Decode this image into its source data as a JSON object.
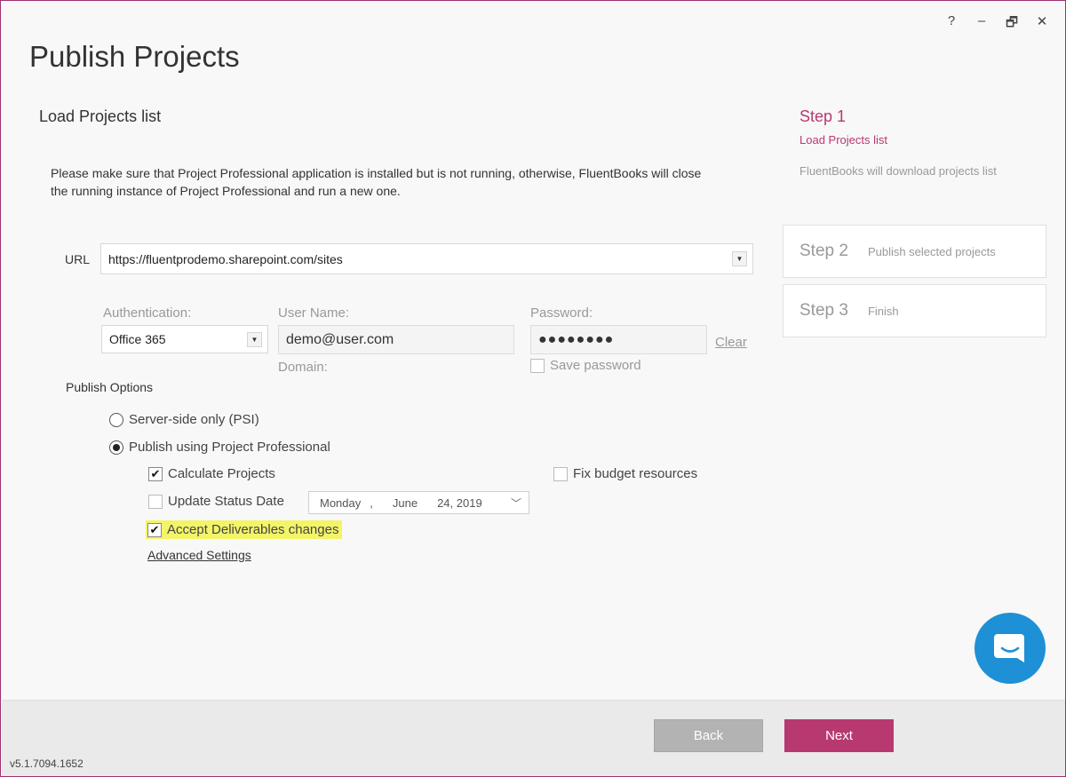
{
  "window": {
    "title": "Publish Projects",
    "controls": {
      "help": "?",
      "minimize": "–",
      "restore": "🗗",
      "close": "✕"
    }
  },
  "section_title": "Load Projects list",
  "notice": "Please make sure that Project Professional application is installed but is not running, otherwise, FluentBooks will close the running instance of Project Professional and run a new one.",
  "url": {
    "label": "URL",
    "value": "https://fluentprodemo.sharepoint.com/sites"
  },
  "auth": {
    "label": "Authentication:",
    "value": "Office 365"
  },
  "username": {
    "label": "User Name:",
    "value": "demo@user.com"
  },
  "domain": {
    "label": "Domain:"
  },
  "password": {
    "label": "Password:",
    "value": "●●●●●●●●",
    "clear_label": "Clear",
    "save_label": "Save password",
    "save_checked": false
  },
  "publish_options": {
    "label": "Publish Options",
    "radio_server": "Server-side only (PSI)",
    "radio_professional": "Publish using Project Professional",
    "selected": "professional",
    "calculate_projects": {
      "label": "Calculate Projects",
      "checked": true
    },
    "fix_budget": {
      "label": "Fix budget resources",
      "checked": false
    },
    "update_status_date": {
      "label": "Update Status Date",
      "checked": false
    },
    "date": {
      "weekday": "Monday",
      "sep": ",",
      "month": "June",
      "day_year": "24, 2019"
    },
    "accept_deliverables": {
      "label": "Accept Deliverables changes",
      "checked": true
    },
    "advanced_settings": "Advanced Settings"
  },
  "steps": {
    "step1": {
      "title": "Step 1",
      "subtitle": "Load Projects list",
      "description": "FluentBooks will download projects list"
    },
    "step2": {
      "title": "Step 2",
      "text": "Publish selected projects"
    },
    "step3": {
      "title": "Step 3",
      "text": "Finish"
    }
  },
  "footer": {
    "back_label": "Back",
    "next_label": "Next",
    "version": "v5.1.7094.1652"
  },
  "colors": {
    "accent": "#b8396f",
    "chat": "#1e90d6",
    "highlight": "#f4f469"
  }
}
